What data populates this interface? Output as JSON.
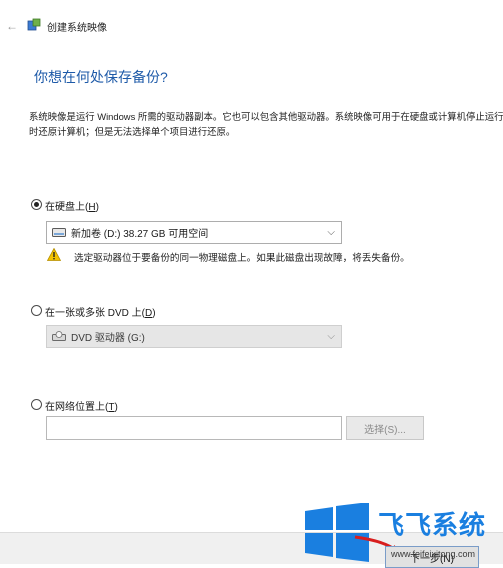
{
  "window": {
    "title": "创建系统映像",
    "icons": {
      "back": "back-arrow-icon",
      "title": "backup-icon"
    }
  },
  "page": {
    "heading": "你想在何处保存备份?",
    "description": "系统映像是运行 Windows 所需的驱动器副本。它也可以包含其他驱动器。系统映像可用于在硬盘或计算机停止运行时还原计算机；但是无法选择单个项目进行还原。"
  },
  "options": {
    "hard_disk": {
      "label": "在硬盘上(",
      "accel": "H",
      "close": ")",
      "selected": true,
      "select_value": "新加卷 (D:)  38.27 GB 可用空间",
      "warning": "选定驱动器位于要备份的同一物理磁盘上。如果此磁盘出现故障，将丢失备份。"
    },
    "dvd": {
      "label": "在一张或多张 DVD 上(",
      "accel": "D",
      "close": ")",
      "selected": false,
      "select_value": "DVD 驱动器 (G:)"
    },
    "network": {
      "label": "在网络位置上(",
      "accel": "T",
      "close": ")",
      "selected": false,
      "path_value": "",
      "browse_label": "选择(S)..."
    }
  },
  "footer": {
    "next_label": "下一步(N)"
  },
  "watermark": {
    "text": "飞飞系统",
    "url": "www.feifeixitong.com"
  },
  "colors": {
    "heading": "#1e5aa8",
    "watermark": "#1a7fe0",
    "warning": "#f2c200"
  }
}
